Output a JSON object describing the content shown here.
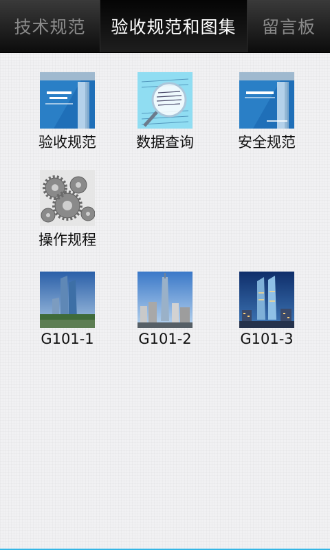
{
  "tabs": [
    {
      "label": "技术规范",
      "active": false
    },
    {
      "label": "验收规范和图集",
      "active": true
    },
    {
      "label": "留言板",
      "active": false
    }
  ],
  "grid": {
    "items": [
      {
        "label": "验收规范",
        "icon": "building-code-book-icon"
      },
      {
        "label": "数据查询",
        "icon": "magnifier-data-icon"
      },
      {
        "label": "安全规范",
        "icon": "safety-code-book-icon"
      },
      {
        "label": "操作规程",
        "icon": "gears-icon"
      },
      {
        "label": "G101-1",
        "icon": "skyscraper-photo-icon"
      },
      {
        "label": "G101-2",
        "icon": "city-tower-photo-icon"
      },
      {
        "label": "G101-3",
        "icon": "twin-towers-night-icon"
      }
    ]
  },
  "colors": {
    "accent": "#33b5e5",
    "tab_active_text": "#ffffff",
    "tab_inactive_text": "#8a8a8a"
  }
}
